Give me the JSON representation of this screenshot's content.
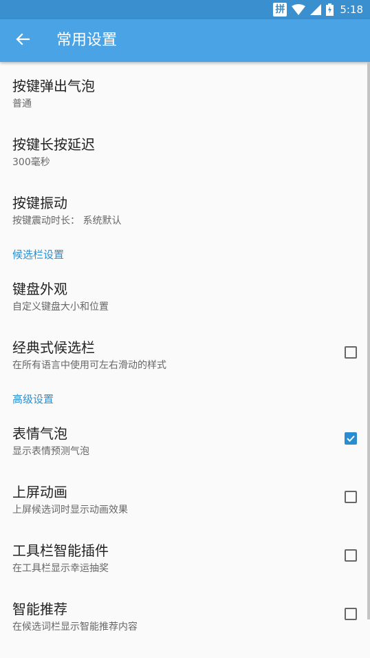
{
  "status_bar": {
    "ime_label": "拼",
    "time": "5:18",
    "icons": [
      "wifi-icon",
      "signal-icon",
      "battery-icon"
    ]
  },
  "app_bar": {
    "title": "常用设置",
    "back_icon": "arrow-left-icon"
  },
  "items_top": [
    {
      "title": "按键弹出气泡",
      "subtitle": "普通"
    },
    {
      "title": "按键长按延迟",
      "subtitle": "300毫秒"
    },
    {
      "title": "按键振动",
      "subtitle": "按键震动时长： 系统默认"
    }
  ],
  "section_candidate": {
    "label": "候选栏设置",
    "items": [
      {
        "title": "键盘外观",
        "subtitle": "自定义键盘大小和位置"
      },
      {
        "title": "经典式候选栏",
        "subtitle": "在所有语言中使用可左右滑动的样式",
        "checked": false
      }
    ]
  },
  "section_advanced": {
    "label": "高级设置",
    "items": [
      {
        "title": "表情气泡",
        "subtitle": "显示表情预测气泡",
        "checked": true
      },
      {
        "title": "上屏动画",
        "subtitle": "上屏候选词时显示动画效果",
        "checked": false
      },
      {
        "title": "工具栏智能插件",
        "subtitle": "在工具栏显示幸运抽奖",
        "checked": false
      },
      {
        "title": "智能推荐",
        "subtitle": "在候选词栏显示智能推荐内容",
        "checked": false
      }
    ]
  },
  "colors": {
    "status_bar": "#3a8fcf",
    "app_bar": "#4aa3e4",
    "accent": "#2a8fd0",
    "background": "#fafafa"
  }
}
